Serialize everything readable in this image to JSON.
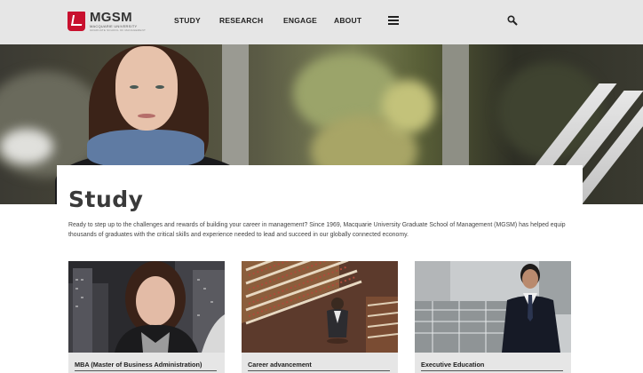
{
  "logo": {
    "name": "MGSM",
    "sub": "MACQUARIE UNIVERSITY",
    "sub2": "GRADUATE SCHOOL OF MANAGEMENT"
  },
  "nav": {
    "items": [
      {
        "label": "STUDY"
      },
      {
        "label": "RESEARCH"
      },
      {
        "label": "ENGAGE"
      },
      {
        "label": "ABOUT"
      }
    ],
    "menu_icon": "hamburger-menu-icon",
    "search_icon": "search-icon"
  },
  "page": {
    "title": "Study",
    "intro": "Ready to step up to the challenges and rewards of building your career in management? Since 1969, Macquarie University Graduate School of Management (MGSM) has helped equip thousands of graduates with the critical skills and experience needed to lead and succeed in our globally connected economy."
  },
  "tiles": [
    {
      "label": "MBA (Master of Business Administration)"
    },
    {
      "label": "Career advancement"
    },
    {
      "label": "Executive Education"
    }
  ],
  "colors": {
    "header_bg": "#e6e6e6",
    "brand_red": "#c8102e",
    "caption_bg": "#e6e6e6"
  }
}
